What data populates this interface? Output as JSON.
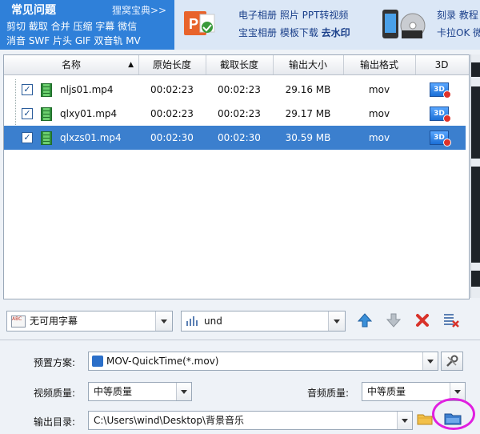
{
  "banner": {
    "faq_title": "常见问题",
    "more_link": "狸窝宝典>>",
    "faq_line1": "剪切 截取 合并 压缩 字幕 微信",
    "faq_line2": "消音 SWF 片头 GIF 双音轨 MV",
    "ad1_line1": "电子相册 照片 PPT转视频",
    "ad1_line2_a": "宝宝相册 模板下载 ",
    "ad1_line2_b": "去水印",
    "ad2_line1": "刻录 教程",
    "ad2_line2": "卡拉OK 微信"
  },
  "columns": [
    "名称",
    "原始长度",
    "截取长度",
    "输出大小",
    "输出格式",
    "3D"
  ],
  "files": [
    {
      "name": "nljs01.mp4",
      "original": "00:02:23",
      "clip": "00:02:23",
      "size": "29.16 MB",
      "format": "mov",
      "badge": "3D",
      "selected": false
    },
    {
      "name": "qlxy01.mp4",
      "original": "00:02:23",
      "clip": "00:02:23",
      "size": "29.17 MB",
      "format": "mov",
      "badge": "3D",
      "selected": false
    },
    {
      "name": "qlxzs01.mp4",
      "original": "00:02:30",
      "clip": "00:02:30",
      "size": "30.59 MB",
      "format": "mov",
      "badge": "3D",
      "selected": true
    }
  ],
  "toolbar": {
    "subtitle_value": "无可用字幕",
    "subtitle_icon_text": "ABC",
    "audio_track_value": "und"
  },
  "settings": {
    "preset_label": "预置方案:",
    "preset_value": "MOV-QuickTime(*.mov)",
    "video_quality_label": "视频质量:",
    "video_quality_value": "中等质量",
    "audio_quality_label": "音频质量:",
    "audio_quality_value": "中等质量",
    "output_dir_label": "输出目录:",
    "output_dir_value": "C:\\Users\\wind\\Desktop\\背景音乐"
  },
  "colors": {
    "faq_bg": "#2f80d9",
    "selected_row": "#3b7fce",
    "highlight_circle": "#e020e0"
  }
}
